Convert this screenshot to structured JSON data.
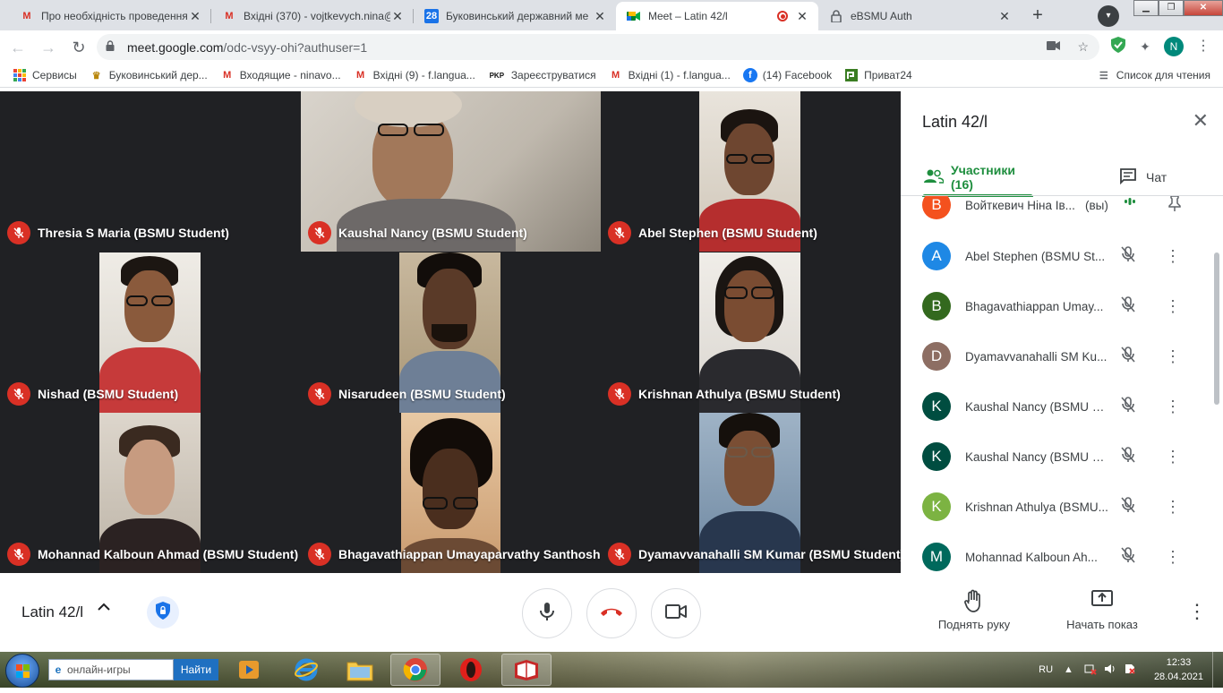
{
  "browser": {
    "tabs": [
      {
        "title": "Про необхідність проведення",
        "icon": "gmail-icon"
      },
      {
        "title": "Вхідні (370) - vojtkevych.nina@",
        "icon": "gmail-icon"
      },
      {
        "title": "Буковинський державний ме",
        "icon": "calendar-icon",
        "icon_text": "28"
      },
      {
        "title": "Meet – Latin 42/l",
        "icon": "meet-icon",
        "active": true
      },
      {
        "title": "eBSMU Auth",
        "icon": "lock-icon"
      }
    ],
    "url_host": "meet.google.com",
    "url_path": "/odc-vsyy-ohi?authuser=1",
    "profile_initial": "N",
    "bookmarks": [
      {
        "label": "Сервисы",
        "icon": "apps-icon"
      },
      {
        "label": "Буковинський дер...",
        "icon": "university-icon"
      },
      {
        "label": "Входящие - ninavo...",
        "icon": "gmail-icon"
      },
      {
        "label": "Вхідні (9) - f.langua...",
        "icon": "gmail-icon"
      },
      {
        "label": "Зареєструватися",
        "icon": "pkp-icon",
        "icon_text": "PKP"
      },
      {
        "label": "Вхідні (1) - f.langua...",
        "icon": "gmail-icon"
      },
      {
        "label": "(14) Facebook",
        "icon": "facebook-icon"
      },
      {
        "label": "Приват24",
        "icon": "privat-icon"
      }
    ],
    "reading_list": "Список для чтения"
  },
  "tiles": [
    {
      "name": "Thresia S Maria (BSMU Student)"
    },
    {
      "name": "Kaushal Nancy (BSMU Student)"
    },
    {
      "name": "Abel Stephen (BSMU Student)"
    },
    {
      "name": "Nishad (BSMU Student)"
    },
    {
      "name": "Nisarudeen (BSMU Student)"
    },
    {
      "name": "Krishnan Athulya (BSMU Student)"
    },
    {
      "name": "Mohannad Kalboun Ahmad (BSMU Student)"
    },
    {
      "name": "Bhagavathiappan Umayaparvathy Santhosh ..."
    },
    {
      "name": "Dyamavvanahalli SM Kumar (BSMU Student)"
    }
  ],
  "panel": {
    "title": "Latin 42/l",
    "tab_people": "Участники (16)",
    "tab_chat": "Чат",
    "participants": [
      {
        "initial": "В",
        "name": "Войткевич Ніна Ів...",
        "you": "(вы)",
        "color": "#f4511e"
      },
      {
        "initial": "A",
        "name": "Abel Stephen (BSMU St...",
        "color": "#1e88e5"
      },
      {
        "initial": "B",
        "name": "Bhagavathiappan Umay...",
        "color": "#33691e"
      },
      {
        "initial": "D",
        "name": "Dyamavvanahalli SM Ku...",
        "color": "#8d6e63"
      },
      {
        "initial": "K",
        "name": "Kaushal Nancy (BSMU S...",
        "color": "#004d40"
      },
      {
        "initial": "K",
        "name": "Kaushal Nancy (BSMU S...",
        "color": "#004d40"
      },
      {
        "initial": "K",
        "name": "Krishnan Athulya (BSMU...",
        "color": "#7cb342"
      },
      {
        "initial": "M",
        "name": "Mohannad Kalboun Ah...",
        "color": "#00695c"
      }
    ]
  },
  "bottom": {
    "meeting_name": "Latin 42/l",
    "raise_hand": "Поднять руку",
    "present": "Начать показ"
  },
  "taskbar": {
    "search_text": "онлайн-игры",
    "search_button": "Найти",
    "language": "RU",
    "time": "12:33",
    "date": "28.04.2021"
  }
}
